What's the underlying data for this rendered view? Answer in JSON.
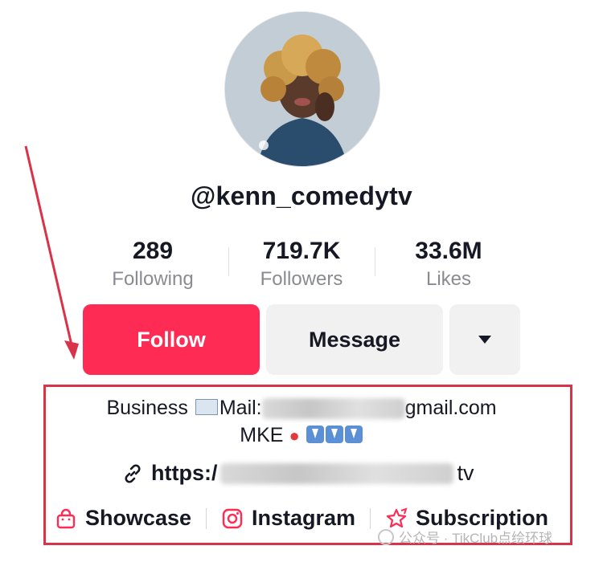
{
  "profile": {
    "username": "@kenn_comedytv",
    "stats": [
      {
        "value": "289",
        "label": "Following"
      },
      {
        "value": "719.7K",
        "label": "Followers"
      },
      {
        "value": "33.6M",
        "label": "Likes"
      }
    ]
  },
  "actions": {
    "follow": "Follow",
    "message": "Message"
  },
  "bio": {
    "line1_prefix": "Business",
    "line1_mail": "Mail:",
    "line1_suffix": "gmail.com",
    "line2": "MKE",
    "link_prefix": "https:/",
    "link_suffix": "tv"
  },
  "links": [
    {
      "label": "Showcase",
      "icon": "shopping-bag-icon"
    },
    {
      "label": "Instagram",
      "icon": "instagram-icon"
    },
    {
      "label": "Subscription",
      "icon": "subscription-star-icon"
    }
  ],
  "watermark": "公众号 · TikClub点绘环球",
  "colors": {
    "follow": "#fe2c55",
    "annotation": "#d9334a",
    "secondary_button": "#f1f1f2"
  }
}
